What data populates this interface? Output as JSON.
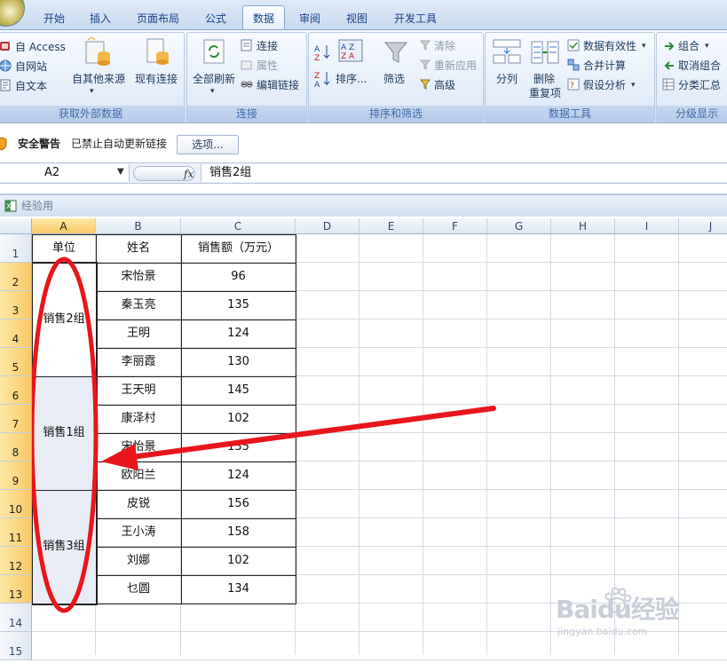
{
  "tabs": [
    "开始",
    "插入",
    "页面布局",
    "公式",
    "数据",
    "审阅",
    "视图",
    "开发工具"
  ],
  "ribbon": {
    "external": {
      "label": "获取外部数据",
      "access": "自 Access",
      "web": "自网站",
      "text": "自文本",
      "other_sources": "自其他来源",
      "existing": "现有连接"
    },
    "connections": {
      "label": "连接",
      "refresh_all": "全部刷新",
      "connections": "连接",
      "properties": "属性",
      "edit_links": "编辑链接"
    },
    "sort_filter": {
      "label": "排序和筛选",
      "sort": "排序...",
      "filter": "筛选",
      "clear": "清除",
      "reapply": "重新应用",
      "advanced": "高级"
    },
    "data_tools": {
      "label": "数据工具",
      "split": "分列",
      "remove_dup_1": "删除",
      "remove_dup_2": "重复项",
      "validation": "数据有效性",
      "consolidate": "合并计算",
      "whatif": "假设分析"
    },
    "outline": {
      "label": "分级显示",
      "group": "组合",
      "ungroup": "取消组合",
      "subtotal": "分类汇总"
    }
  },
  "security": {
    "title": "安全警告",
    "message": "已禁止自动更新链接",
    "options": "选项..."
  },
  "formula_bar": {
    "name_box": "A2",
    "fx": "fx",
    "content": "销售2组"
  },
  "workbook_title": "经验用",
  "columns": [
    "A",
    "B",
    "C",
    "D",
    "E",
    "F",
    "G",
    "H",
    "I",
    "J"
  ],
  "rows": [
    "1",
    "2",
    "3",
    "4",
    "5",
    "6",
    "7",
    "8",
    "9",
    "10",
    "11",
    "12",
    "13",
    "14",
    "15"
  ],
  "table": {
    "headers": [
      "单位",
      "姓名",
      "销售额（万元）"
    ],
    "groups": [
      "销售2组",
      "销售1组",
      "销售3组"
    ],
    "names": [
      "宋怡景",
      "秦玉亮",
      "王明",
      "李丽霞",
      "王天明",
      "康泽村",
      "宋怡景",
      "欧阳兰",
      "皮锐",
      "王小涛",
      "刘娜",
      "乜圆"
    ],
    "sales": [
      "96",
      "135",
      "124",
      "130",
      "145",
      "102",
      "135",
      "124",
      "156",
      "158",
      "102",
      "134"
    ]
  },
  "watermark": {
    "brand": "Baidu经验",
    "url": "jingyan.baidu.com"
  },
  "colors": {
    "annotation": "#e8161b",
    "selected_header": "#f8c866",
    "merged_fill": "#e8ecf5"
  }
}
